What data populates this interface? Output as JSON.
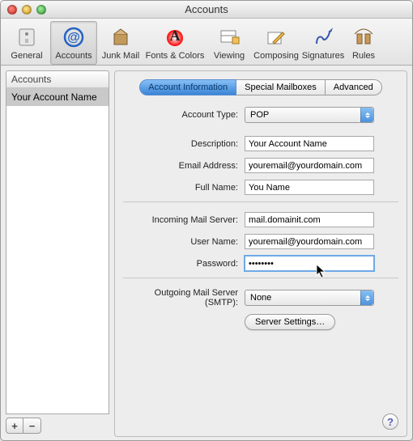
{
  "window": {
    "title": "Accounts"
  },
  "toolbar": [
    {
      "id": "general",
      "label": "General"
    },
    {
      "id": "accounts",
      "label": "Accounts"
    },
    {
      "id": "junk",
      "label": "Junk Mail"
    },
    {
      "id": "fonts",
      "label": "Fonts & Colors"
    },
    {
      "id": "viewing",
      "label": "Viewing"
    },
    {
      "id": "composing",
      "label": "Composing"
    },
    {
      "id": "signatures",
      "label": "Signatures"
    },
    {
      "id": "rules",
      "label": "Rules"
    }
  ],
  "sidebar": {
    "header": "Accounts",
    "items": [
      {
        "label": "Your Account Name"
      }
    ],
    "add_label": "+",
    "remove_label": "−"
  },
  "tabs": [
    {
      "label": "Account Information",
      "active": true
    },
    {
      "label": "Special Mailboxes",
      "active": false
    },
    {
      "label": "Advanced",
      "active": false
    }
  ],
  "form": {
    "account_type_label": "Account Type:",
    "account_type_value": "POP",
    "description_label": "Description:",
    "description_value": "Your Account Name",
    "email_label": "Email Address:",
    "email_value": "youremail@yourdomain.com",
    "fullname_label": "Full Name:",
    "fullname_value": "You Name",
    "incoming_label": "Incoming Mail Server:",
    "incoming_value": "mail.domainit.com",
    "username_label": "User Name:",
    "username_value": "youremail@yourdomain.com",
    "password_label": "Password:",
    "password_value": "••••••••",
    "smtp_label": "Outgoing Mail Server (SMTP):",
    "smtp_value": "None",
    "server_settings_label": "Server Settings…"
  },
  "help_label": "?"
}
